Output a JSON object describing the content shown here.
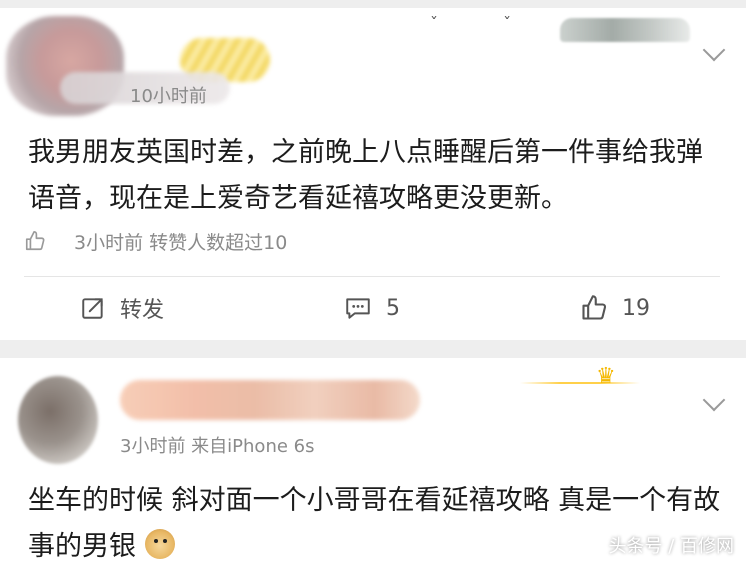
{
  "post1": {
    "time_text": "10小时前",
    "content": "我男朋友英国时差，之前晚上八点睡醒后第一件事给我弹语音，现在是上爱奇艺看延禧攻略更没更新。",
    "sub_meta": "3小时前  转赞人数超过10",
    "actions": {
      "repost_label": "转发",
      "comment_count": "5",
      "like_count": "19"
    }
  },
  "post2": {
    "time_text": "3小时前  来自iPhone 6s",
    "content": "坐车的时候 斜对面一个小哥哥在看延禧攻略 真是一个有故事的男银"
  },
  "watermark": "头条号 / 百修网",
  "icons": {
    "like": "thumbs-up-icon",
    "repost": "share-icon",
    "comment": "comment-icon",
    "expand": "chevron-down-icon"
  },
  "colors": {
    "separator": "#eeeeee",
    "meta_text": "#8a8a8a",
    "body_text": "#1c1c1c"
  }
}
